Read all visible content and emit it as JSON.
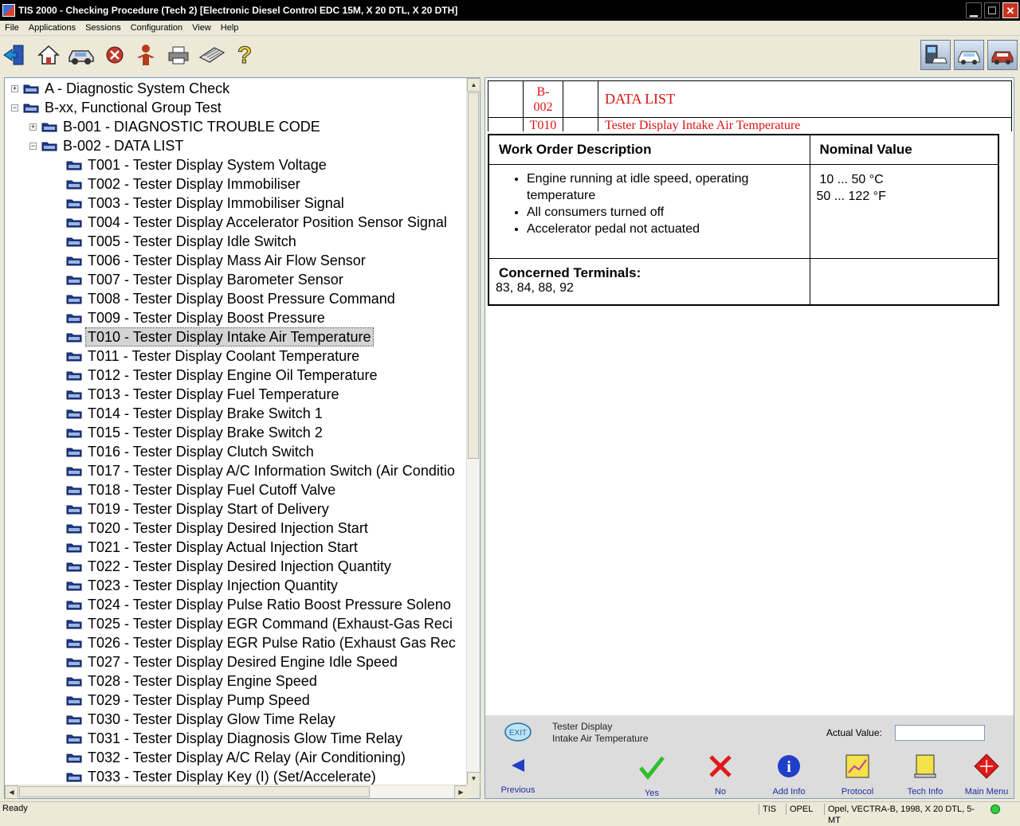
{
  "window": {
    "title": "TIS 2000 - Checking Procedure (Tech 2) [Electronic Diesel Control EDC 15M, X 20 DTL, X 20 DTH]",
    "minimize": "▁",
    "maximize": "☐",
    "close": "✕"
  },
  "menu": [
    "File",
    "Applications",
    "Sessions",
    "Configuration",
    "View",
    "Help"
  ],
  "toolbar": {
    "icons": [
      "exit-icon",
      "home-icon",
      "vehicle-icon",
      "stop-icon",
      "user-icon",
      "print-icon",
      "keyboard-icon",
      "help-icon"
    ],
    "right_icons": [
      "tech2-device-icon",
      "vehicle-interface-icon",
      "car-service-icon"
    ]
  },
  "tree": {
    "items": [
      {
        "label": "A - Diagnostic System Check",
        "level": 0,
        "expander": "+"
      },
      {
        "label": "B-xx, Functional Group Test",
        "level": 0,
        "expander": "−"
      },
      {
        "label": "B-001 - DIAGNOSTIC TROUBLE CODE",
        "level": 1,
        "expander": "+"
      },
      {
        "label": "B-002 - DATA LIST",
        "level": 1,
        "expander": "−"
      },
      {
        "label": "T001 - Tester Display System Voltage",
        "level": 2
      },
      {
        "label": "T002 - Tester Display Immobiliser",
        "level": 2
      },
      {
        "label": "T003 - Tester Display Immobiliser Signal",
        "level": 2
      },
      {
        "label": "T004 - Tester Display Accelerator Position Sensor Signal",
        "level": 2
      },
      {
        "label": "T005 - Tester Display Idle Switch",
        "level": 2
      },
      {
        "label": "T006 - Tester Display Mass Air Flow Sensor",
        "level": 2
      },
      {
        "label": "T007 - Tester Display Barometer Sensor",
        "level": 2
      },
      {
        "label": "T008 - Tester Display Boost Pressure Command",
        "level": 2
      },
      {
        "label": "T009 - Tester Display Boost Pressure",
        "level": 2
      },
      {
        "label": "T010 - Tester Display Intake Air Temperature",
        "level": 2,
        "selected": true
      },
      {
        "label": "T011 - Tester Display Coolant Temperature",
        "level": 2
      },
      {
        "label": "T012 - Tester Display Engine Oil Temperature",
        "level": 2
      },
      {
        "label": "T013 - Tester Display Fuel Temperature",
        "level": 2
      },
      {
        "label": "T014 - Tester Display Brake Switch 1",
        "level": 2
      },
      {
        "label": "T015 - Tester Display Brake Switch 2",
        "level": 2
      },
      {
        "label": "T016 - Tester Display Clutch Switch",
        "level": 2
      },
      {
        "label": "T017 - Tester Display A/C Information Switch (Air Conditio",
        "level": 2
      },
      {
        "label": "T018 - Tester Display Fuel Cutoff Valve",
        "level": 2
      },
      {
        "label": "T019 - Tester Display Start of Delivery",
        "level": 2
      },
      {
        "label": "T020 - Tester Display Desired Injection Start",
        "level": 2
      },
      {
        "label": "T021 - Tester Display Actual Injection Start",
        "level": 2
      },
      {
        "label": "T022 - Tester Display Desired Injection Quantity",
        "level": 2
      },
      {
        "label": "T023 - Tester Display Injection Quantity",
        "level": 2
      },
      {
        "label": "T024 - Tester Display Pulse Ratio Boost Pressure Soleno",
        "level": 2
      },
      {
        "label": "T025 - Tester Display EGR Command (Exhaust-Gas Reci",
        "level": 2
      },
      {
        "label": "T026 - Tester Display EGR Pulse Ratio (Exhaust Gas Rec",
        "level": 2
      },
      {
        "label": "T027 - Tester Display Desired Engine Idle Speed",
        "level": 2
      },
      {
        "label": "T028 - Tester Display Engine Speed",
        "level": 2
      },
      {
        "label": "T029 - Tester Display Pump Speed",
        "level": 2
      },
      {
        "label": "T030 - Tester Display Glow Time Relay",
        "level": 2
      },
      {
        "label": "T031 - Tester Display Diagnosis Glow Time Relay",
        "level": 2
      },
      {
        "label": "T032 - Tester Display A/C Relay (Air Conditioning)",
        "level": 2
      },
      {
        "label": "T033 - Tester Display Key (I) (Set/Accelerate)",
        "level": 2
      }
    ]
  },
  "document": {
    "header_code1": "B-",
    "header_code2": "002",
    "header_title": "DATA LIST",
    "header2_code": "T010",
    "header2_title": "Tester Display Intake Air Temperature",
    "col_work_order": "Work Order Description",
    "col_nominal": "Nominal Value",
    "conditions": [
      "Engine running at idle speed, operating temperature",
      "All consumers turned off",
      "Accelerator pedal not actuated"
    ],
    "nominal_c": "10 ... 50 °C",
    "nominal_f": "50 ... 122 °F",
    "terminals_label": "Concerned Terminals:",
    "terminals_value": "83, 84, 88, 92"
  },
  "bottom": {
    "display_line1": "Tester Display",
    "display_line2": "Intake Air Temperature",
    "actual_value_label": "Actual Value:",
    "actual_value": "",
    "buttons": {
      "previous": "Previous",
      "yes": "Yes",
      "no": "No",
      "add_info": "Add Info",
      "protocol": "Protocol",
      "tech_info": "Tech Info",
      "main_menu": "Main Menu"
    }
  },
  "status": {
    "ready": "Ready",
    "app": "TIS",
    "brand": "OPEL",
    "vehicle": "Opel, VECTRA-B, 1998, X 20 DTL, 5-MT"
  },
  "colors": {
    "doc_header_red": "#e01010",
    "link_blue": "#1d2f9e",
    "status_ok": "#2ecc40"
  }
}
